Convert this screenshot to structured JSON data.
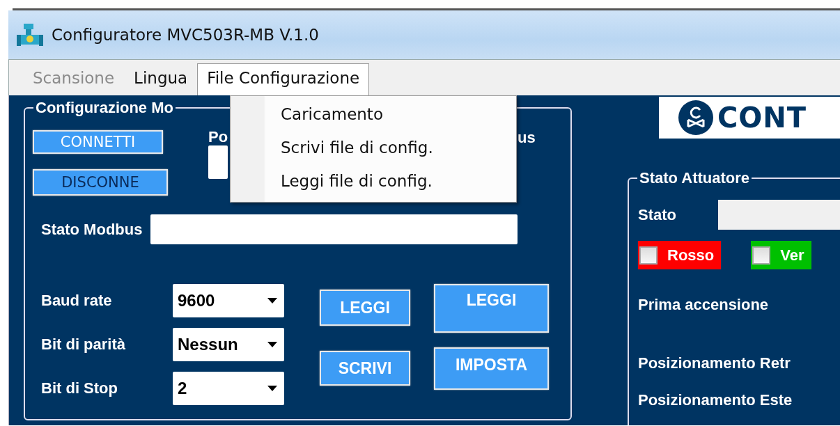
{
  "window": {
    "title": "Configuratore MVC503R-MB V.1.0"
  },
  "menu": [
    {
      "label": "Scansione",
      "disabled": true,
      "selected": false
    },
    {
      "label": "Lingua",
      "disabled": false,
      "selected": false
    },
    {
      "label": "File Configurazione",
      "disabled": false,
      "selected": true
    }
  ],
  "dropdown": {
    "items": [
      "Caricamento",
      "Scrivi file di config.",
      "Leggi file di config."
    ]
  },
  "modbus_group": {
    "title": "Configurazione Mo",
    "connect_button": "CONNETTI",
    "disconnect_button": "DISCONNE",
    "port_label": "Po",
    "label_fragment": "us",
    "status_label": "Stato Modbus",
    "settings": [
      {
        "label": "Baud rate",
        "value": "9600"
      },
      {
        "label": "Bit di parità",
        "value": "Nessun"
      },
      {
        "label": "Bit di Stop",
        "value": "2"
      }
    ],
    "buttons_left": [
      "LEGGI",
      "SCRIVI"
    ],
    "buttons_right": [
      "LEGGI",
      "IMPOSTA"
    ]
  },
  "logo": {
    "text": "CONT"
  },
  "actuator_group": {
    "title": "Stato Attuatore",
    "status_label": "Stato",
    "indicators": [
      {
        "label": "Rosso",
        "checked": false,
        "color": "#ff0000"
      },
      {
        "label": "Ver",
        "checked": false,
        "color": "#00c000"
      }
    ],
    "labels": [
      "Prima accensione",
      "Posizionamento Retr",
      "Posizionamento Este"
    ]
  }
}
